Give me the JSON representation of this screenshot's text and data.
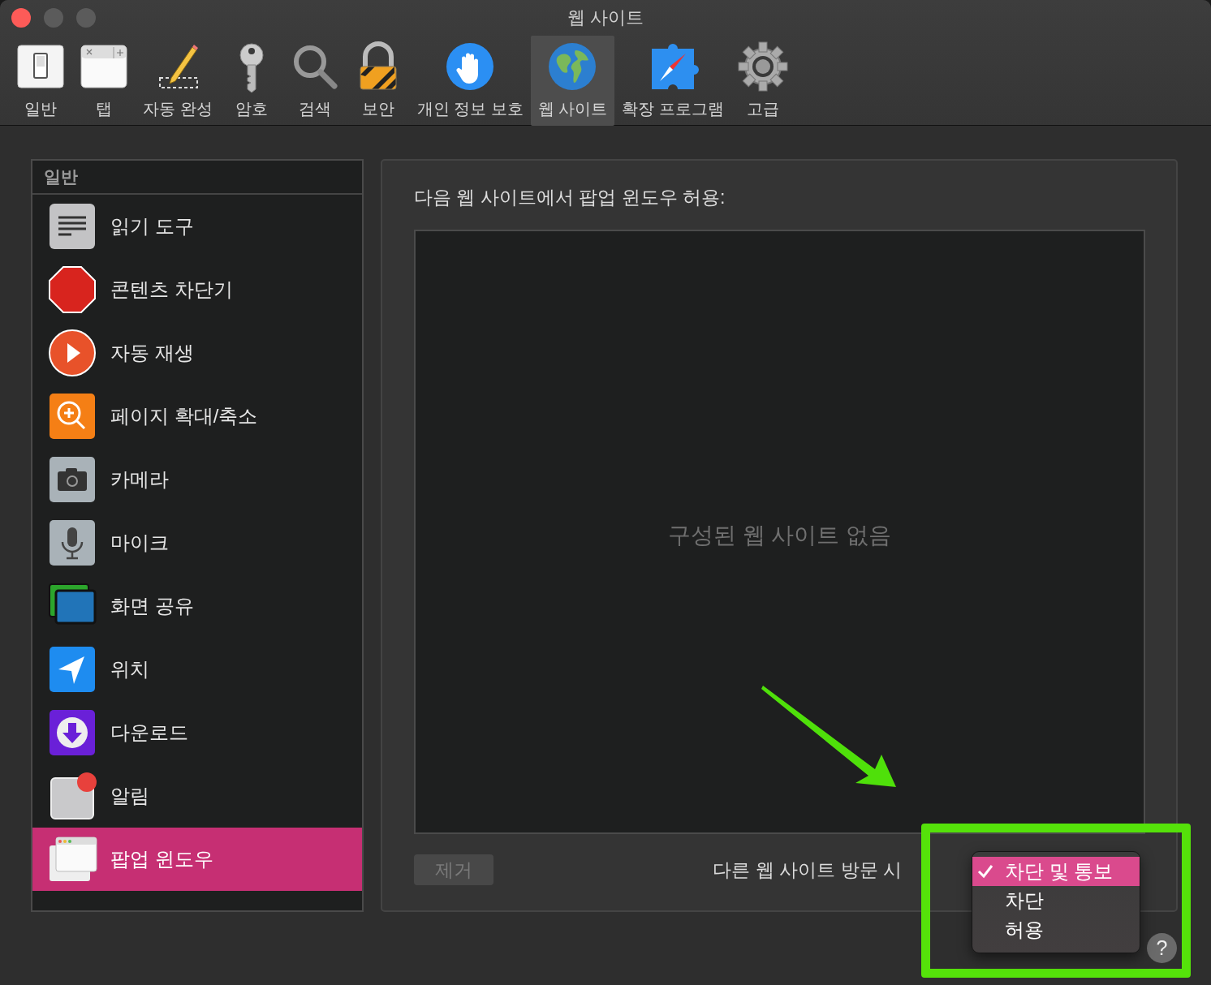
{
  "window": {
    "title": "웹 사이트"
  },
  "toolbar": [
    {
      "label": "일반",
      "kind": "switch",
      "selected": false
    },
    {
      "label": "탭",
      "kind": "tabs",
      "selected": false
    },
    {
      "label": "자동 완성",
      "kind": "autofill",
      "selected": false
    },
    {
      "label": "암호",
      "kind": "passwords",
      "selected": false
    },
    {
      "label": "검색",
      "kind": "search",
      "selected": false
    },
    {
      "label": "보안",
      "kind": "security",
      "selected": false
    },
    {
      "label": "개인 정보 보호",
      "kind": "privacy",
      "selected": false
    },
    {
      "label": "웹 사이트",
      "kind": "websites",
      "selected": true
    },
    {
      "label": "확장 프로그램",
      "kind": "extensions",
      "selected": false
    },
    {
      "label": "고급",
      "kind": "advanced",
      "selected": false
    }
  ],
  "sidebar": {
    "header": "일반",
    "items": [
      {
        "label": "읽기 도구",
        "kind": "reader",
        "selected": false
      },
      {
        "label": "콘텐츠 차단기",
        "kind": "content-blocker",
        "selected": false
      },
      {
        "label": "자동 재생",
        "kind": "autoplay",
        "selected": false
      },
      {
        "label": "페이지 확대/축소",
        "kind": "zoom",
        "selected": false
      },
      {
        "label": "카메라",
        "kind": "camera",
        "selected": false
      },
      {
        "label": "마이크",
        "kind": "microphone",
        "selected": false
      },
      {
        "label": "화면 공유",
        "kind": "screen-sharing",
        "selected": false
      },
      {
        "label": "위치",
        "kind": "location",
        "selected": false
      },
      {
        "label": "다운로드",
        "kind": "downloads",
        "selected": false
      },
      {
        "label": "알림",
        "kind": "notifications",
        "selected": false
      },
      {
        "label": "팝업 윈도우",
        "kind": "popup",
        "selected": true
      }
    ]
  },
  "content": {
    "heading": "다음 웹 사이트에서 팝업 윈도우 허용:",
    "empty_message": "구성된 웹 사이트 없음",
    "remove_button": {
      "label": "제거",
      "disabled": true
    },
    "when_visiting_label": "다른 웹 사이트 방문 시",
    "menu": [
      {
        "label": "차단 및 통보",
        "selected": true
      },
      {
        "label": "차단",
        "selected": false
      },
      {
        "label": "허용",
        "selected": false
      }
    ]
  },
  "help_button": "?"
}
